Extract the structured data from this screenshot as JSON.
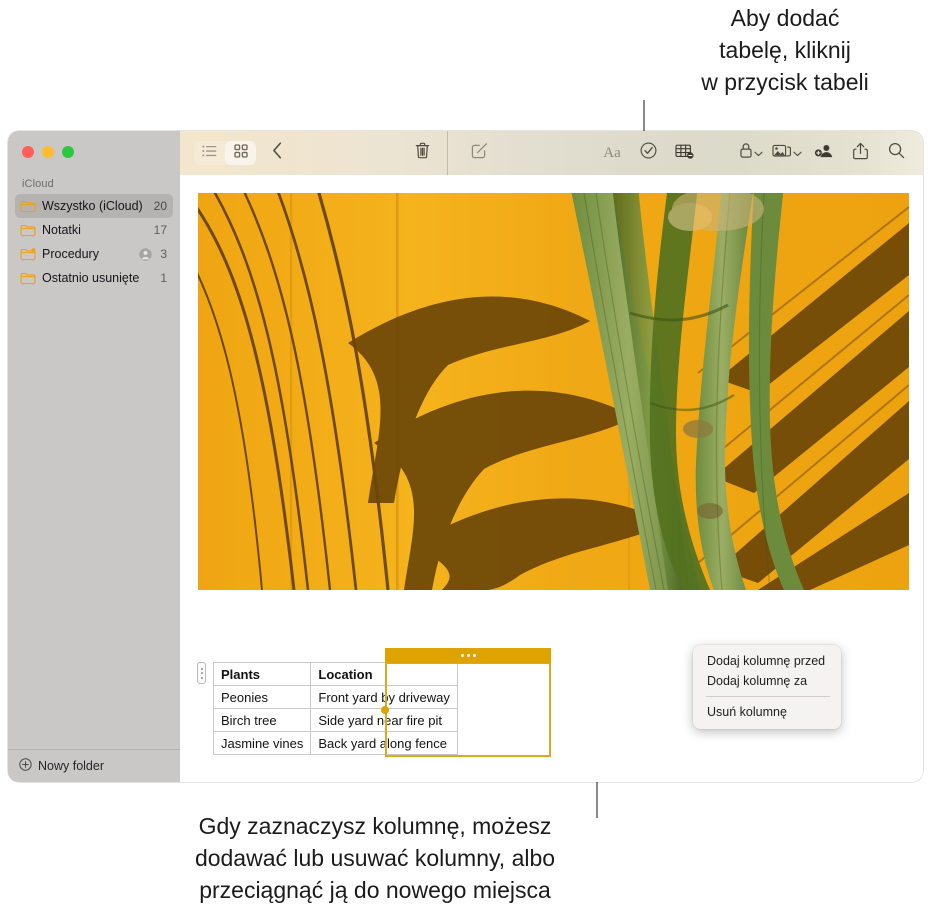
{
  "callouts": {
    "top": "Aby dodać\ntabelę, kliknij\nw przycisk tabeli",
    "bottom": "Gdy zaznaczysz kolumnę, możesz\ndodawać lub usuwać kolumny, albo\nprzeciągnąć ją do nowego miejsca"
  },
  "window": {
    "traffic_lights": [
      "close",
      "minimize",
      "zoom"
    ]
  },
  "sidebar": {
    "section_label": "iCloud",
    "items": [
      {
        "label": "Wszystko (iCloud)",
        "count": "20",
        "icon": "folder-icon",
        "selected": true,
        "shared": false,
        "has_person": false
      },
      {
        "label": "Notatki",
        "count": "17",
        "icon": "folder-icon",
        "selected": false,
        "shared": false,
        "has_person": false
      },
      {
        "label": "Procedury",
        "count": "3",
        "icon": "shared-folder-icon",
        "selected": false,
        "shared": true,
        "has_person": true
      },
      {
        "label": "Ostatnio usunięte",
        "count": "1",
        "icon": "folder-icon",
        "selected": false,
        "shared": false,
        "has_person": false
      }
    ],
    "footer": {
      "label": "Nowy folder",
      "icon": "plus-circle-icon"
    }
  },
  "toolbar": {
    "view_list": {
      "name": "list-view-button",
      "icon": "list-icon",
      "active": false
    },
    "view_grid": {
      "name": "gallery-view-button",
      "icon": "grid-icon",
      "active": true
    },
    "back": {
      "name": "back-button",
      "icon": "chevron-left-icon"
    },
    "delete": {
      "name": "delete-note-button",
      "icon": "trash-icon"
    },
    "compose": {
      "name": "new-note-button",
      "icon": "compose-icon"
    },
    "format": {
      "name": "format-button",
      "icon": "aa-icon",
      "label": "Aa"
    },
    "checklist": {
      "name": "checklist-button",
      "icon": "check-circle-icon"
    },
    "table": {
      "name": "table-button",
      "icon": "table-icon"
    },
    "lock": {
      "name": "lock-button",
      "icon": "lock-icon",
      "chevron": true
    },
    "media": {
      "name": "media-button",
      "icon": "photos-icon",
      "chevron": true
    },
    "collaborate": {
      "name": "collaborate-button",
      "icon": "person-add-icon"
    },
    "share": {
      "name": "share-button",
      "icon": "share-icon"
    },
    "search": {
      "name": "search-button",
      "icon": "search-icon"
    }
  },
  "note": {
    "photo": {
      "alt": "Green palm stalks against an orange wall with palm frond shadows",
      "colors": {
        "wall": "#f0a81a",
        "wall_light": "#f5b51f",
        "shadow": "#70490a",
        "stalk": "#7f9a4c",
        "stalk_dark": "#4e6b28"
      }
    },
    "table": {
      "headers": [
        "Plants",
        "Location"
      ],
      "rows": [
        [
          "Peonies",
          "Front yard by driveway"
        ],
        [
          "Birch tree",
          "Side yard near fire pit"
        ],
        [
          "Jasmine vines",
          "Back yard along fence"
        ]
      ],
      "selected_column_index": 1,
      "selection_color": "#dfa300"
    }
  },
  "context_menu": {
    "items": [
      {
        "label": "Dodaj kolumnę przed",
        "separator_after": false
      },
      {
        "label": "Dodaj kolumnę za",
        "separator_after": true
      },
      {
        "label": "Usuń kolumnę",
        "separator_after": false
      }
    ]
  }
}
